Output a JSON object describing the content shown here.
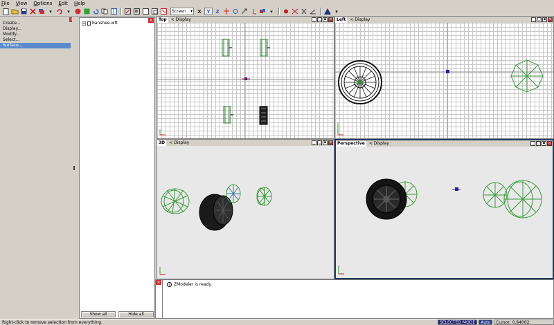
{
  "menu": [
    "File",
    "View",
    "Options",
    "Edit",
    "Help"
  ],
  "toolbar": {
    "units_value": "Screen",
    "axis_x": "X",
    "axis_y": "Y",
    "axis_z": "Z"
  },
  "commands": [
    "Create...",
    "Display...",
    "Modify...",
    "Select...",
    "Surface..."
  ],
  "commands_selected": "Surface...",
  "tree": {
    "item": "banshee.wft",
    "show_all": "Show all",
    "hide_all": "Hide all"
  },
  "viewports": {
    "top": {
      "name": "Top",
      "display": "< Display"
    },
    "left": {
      "name": "Left",
      "display": "< Display"
    },
    "v3d": {
      "name": "3D",
      "display": "< Display"
    },
    "persp": {
      "name": "Perspective",
      "display": "< Display"
    }
  },
  "log": {
    "message": "ZModeler is ready."
  },
  "status": {
    "hint": "Right-click to remove selection from everything.",
    "mode": "SELECTED MODE",
    "auto": "Auto",
    "cursor": "Cursor: 0.84062, -0.68544, -0.29916"
  },
  "colors": {
    "wire_green": "#3a9a3a",
    "selection": "#5b8bcd",
    "active_border": "#1f3b5c"
  }
}
